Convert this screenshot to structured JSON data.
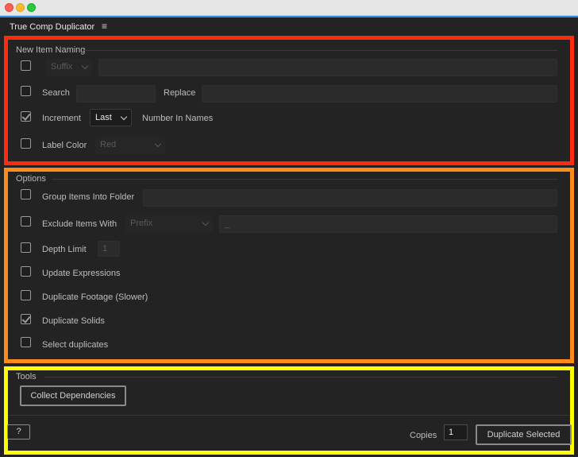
{
  "panel": {
    "title": "True Comp Duplicator",
    "menu_icon": "hamburger-menu-icon"
  },
  "naming": {
    "legend": "New Item Naming",
    "suffix": {
      "checked": false,
      "mode": "Suffix",
      "value": ""
    },
    "search": {
      "checked": false,
      "label": "Search",
      "value": "",
      "replace_label": "Replace",
      "replace_value": ""
    },
    "increment": {
      "checked": true,
      "label": "Increment",
      "position": "Last",
      "suffix_label": "Number In Names"
    },
    "label_color": {
      "checked": false,
      "label": "Label Color",
      "value": "Red"
    }
  },
  "options": {
    "legend": "Options",
    "group_folder": {
      "checked": false,
      "label": "Group Items Into Folder",
      "value": ""
    },
    "exclude": {
      "checked": false,
      "label": "Exclude Items With",
      "mode": "Prefix",
      "value": "_"
    },
    "depth_limit": {
      "checked": false,
      "label": "Depth Limit",
      "value": "1"
    },
    "update_expressions": {
      "checked": false,
      "label": "Update Expressions"
    },
    "duplicate_footage": {
      "checked": false,
      "label": "Duplicate Footage (Slower)"
    },
    "duplicate_solids": {
      "checked": true,
      "label": "Duplicate Solids"
    },
    "select_duplicates": {
      "checked": false,
      "label": "Select duplicates"
    }
  },
  "tools": {
    "legend": "Tools",
    "collect_label": "Collect Dependencies",
    "help_label": "?",
    "copies_label": "Copies",
    "copies_value": "1",
    "duplicate_label": "Duplicate Selected"
  },
  "colors": {
    "accent": "#2d8ceb",
    "section_naming": "#ff2b0f",
    "section_options": "#ff8c1a",
    "section_tools": "#ffff00"
  }
}
